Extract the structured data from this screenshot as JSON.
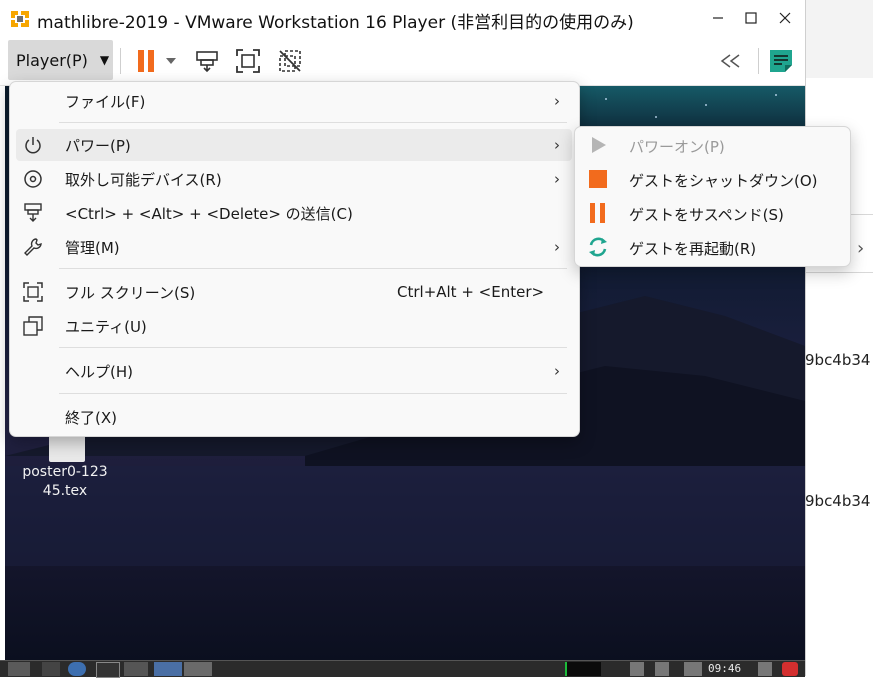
{
  "window": {
    "title": "mathlibre-2019 - VMware Workstation 16 Player (非営利目的の使用のみ)",
    "minimize_icon": "minimize-icon",
    "maximize_icon": "maximize-icon",
    "close_icon": "close-icon"
  },
  "toolbar": {
    "player_menu_label": "Player(P)",
    "icons": [
      "pause-icon",
      "dropdown-caret-icon",
      "send-ctrl-alt-del-icon",
      "fullscreen-icon",
      "unity-disabled-icon",
      "collapse-icon",
      "notes-icon"
    ],
    "accent_pause": "#f26b1d",
    "accent_notes": "#1fa58f"
  },
  "player_menu": {
    "items": [
      {
        "label": "ファイル(F)",
        "has_submenu": true,
        "icon": ""
      },
      {
        "label": "パワー(P)",
        "has_submenu": true,
        "icon": "power-icon",
        "highlighted": true
      },
      {
        "label": "取外し可能デバイス(R)",
        "has_submenu": true,
        "icon": "disc-icon"
      },
      {
        "label": "<Ctrl> + <Alt> + <Delete> の送信(C)",
        "has_submenu": false,
        "icon": "send-keys-icon"
      },
      {
        "label": "管理(M)",
        "has_submenu": true,
        "icon": "wrench-icon"
      },
      {
        "label": "フル スクリーン(S)",
        "shortcut": "Ctrl+Alt + <Enter>",
        "icon": "fullscreen-icon"
      },
      {
        "label": "ユニティ(U)",
        "icon": "unity-icon"
      },
      {
        "label": "ヘルプ(H)",
        "has_submenu": true,
        "icon": ""
      },
      {
        "label": "終了(X)",
        "icon": ""
      }
    ],
    "submenu_arrow": "›"
  },
  "power_submenu": {
    "items": [
      {
        "label": "パワーオン(P)",
        "icon": "play-icon",
        "enabled": false
      },
      {
        "label": "ゲストをシャットダウン(O)",
        "icon": "stop-icon",
        "enabled": true
      },
      {
        "label": "ゲストをサスペンド(S)",
        "icon": "pause-icon",
        "enabled": true
      },
      {
        "label": "ゲストを再起動(R)",
        "icon": "restart-icon",
        "enabled": true
      }
    ],
    "colors": {
      "stop": "#f26b1d",
      "pause": "#f26b1d",
      "restart": "#1fa58f",
      "disabled": "#b5b5b5"
    }
  },
  "desktop": {
    "file_icon_label_line1": "poster0-123",
    "file_icon_label_line2": "45.tex"
  },
  "taskbar": {
    "clock": "09:46"
  },
  "background_app": {
    "hash1": "9bc4b34",
    "hash2": "9bc4b34"
  }
}
